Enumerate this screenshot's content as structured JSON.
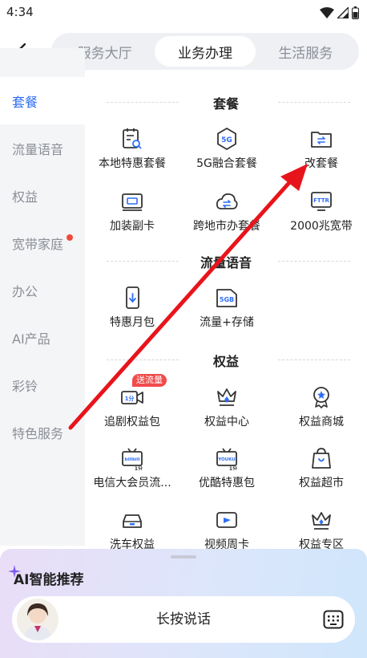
{
  "status": {
    "time": "4:34"
  },
  "tabs": [
    {
      "label": "服务大厅",
      "active": false
    },
    {
      "label": "业务办理",
      "active": true
    },
    {
      "label": "生活服务",
      "active": false
    }
  ],
  "sidebar": {
    "items": [
      {
        "label": "套餐",
        "active": true
      },
      {
        "label": "流量语音",
        "active": false
      },
      {
        "label": "权益",
        "active": false
      },
      {
        "label": "宽带家庭",
        "active": false,
        "dot": true
      },
      {
        "label": "办公",
        "active": false
      },
      {
        "label": "AI产品",
        "active": false
      },
      {
        "label": "彩铃",
        "active": false
      },
      {
        "label": "特色服务",
        "active": false
      }
    ]
  },
  "sections": [
    {
      "title": "套餐",
      "items": [
        "本地特惠套餐",
        "5G融合套餐",
        "改套餐",
        "加装副卡",
        "跨地市办套餐",
        "2000兆宽带"
      ]
    },
    {
      "title": "流量语音",
      "items": [
        "特惠月包",
        "流量+存储"
      ]
    },
    {
      "title": "权益",
      "items": [
        "追剧权益包",
        "权益中心",
        "权益商城",
        "电信大会员流...",
        "优酷特惠包",
        "权益超市",
        "洗车权益",
        "视频周卡",
        "权益专区"
      ]
    }
  ],
  "icon_text": {
    "fiveg": "5G",
    "fttr": "FTTR",
    "fivegb": "5GB",
    "onefen": "1分",
    "bilibili": "bilibili",
    "youku": "YOUKU"
  },
  "badge": "送流量",
  "ai": {
    "title": "AI智能推荐",
    "voice_label": "长按说话"
  },
  "colors": {
    "accent": "#2f6ef5",
    "badge": "#f24b4b",
    "arrow": "#e8141b"
  }
}
